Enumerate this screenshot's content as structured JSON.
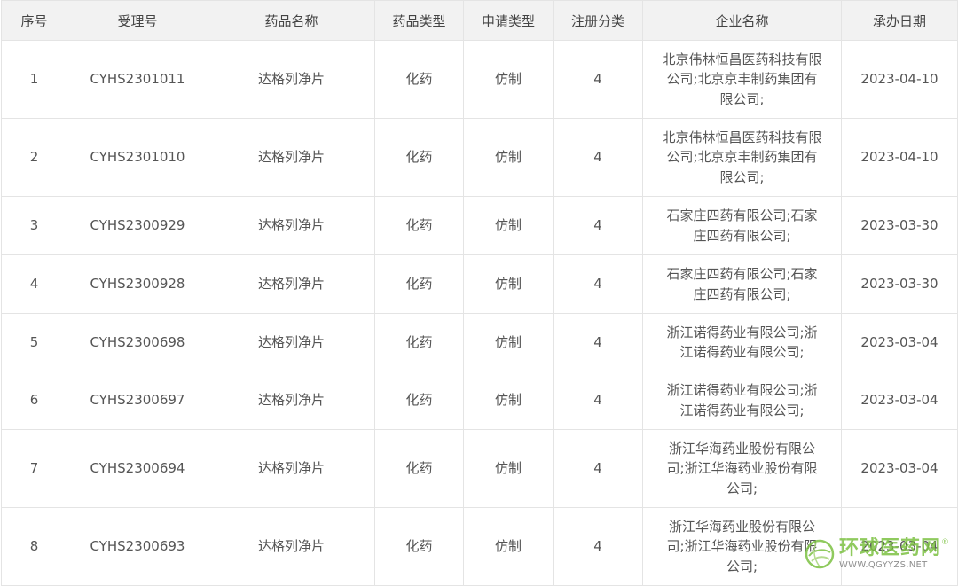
{
  "table": {
    "headers": [
      "序号",
      "受理号",
      "药品名称",
      "药品类型",
      "申请类型",
      "注册分类",
      "企业名称",
      "承办日期"
    ],
    "rows": [
      {
        "seq": "1",
        "accept_no": "CYHS2301011",
        "drug_name": "达格列净片",
        "drug_type": "化药",
        "apply_type": "仿制",
        "reg_class": "4",
        "company": "北京伟林恒昌医药科技有限\n公司;北京京丰制药集团有\n限公司;",
        "date": "2023-04-10"
      },
      {
        "seq": "2",
        "accept_no": "CYHS2301010",
        "drug_name": "达格列净片",
        "drug_type": "化药",
        "apply_type": "仿制",
        "reg_class": "4",
        "company": "北京伟林恒昌医药科技有限\n公司;北京京丰制药集团有\n限公司;",
        "date": "2023-04-10"
      },
      {
        "seq": "3",
        "accept_no": "CYHS2300929",
        "drug_name": "达格列净片",
        "drug_type": "化药",
        "apply_type": "仿制",
        "reg_class": "4",
        "company": "石家庄四药有限公司;石家\n庄四药有限公司;",
        "date": "2023-03-30"
      },
      {
        "seq": "4",
        "accept_no": "CYHS2300928",
        "drug_name": "达格列净片",
        "drug_type": "化药",
        "apply_type": "仿制",
        "reg_class": "4",
        "company": "石家庄四药有限公司;石家\n庄四药有限公司;",
        "date": "2023-03-30"
      },
      {
        "seq": "5",
        "accept_no": "CYHS2300698",
        "drug_name": "达格列净片",
        "drug_type": "化药",
        "apply_type": "仿制",
        "reg_class": "4",
        "company": "浙江诺得药业有限公司;浙\n江诺得药业有限公司;",
        "date": "2023-03-04"
      },
      {
        "seq": "6",
        "accept_no": "CYHS2300697",
        "drug_name": "达格列净片",
        "drug_type": "化药",
        "apply_type": "仿制",
        "reg_class": "4",
        "company": "浙江诺得药业有限公司;浙\n江诺得药业有限公司;",
        "date": "2023-03-04"
      },
      {
        "seq": "7",
        "accept_no": "CYHS2300694",
        "drug_name": "达格列净片",
        "drug_type": "化药",
        "apply_type": "仿制",
        "reg_class": "4",
        "company": "浙江华海药业股份有限公\n司;浙江华海药业股份有限\n公司;",
        "date": "2023-03-04"
      },
      {
        "seq": "8",
        "accept_no": "CYHS2300693",
        "drug_name": "达格列净片",
        "drug_type": "化药",
        "apply_type": "仿制",
        "reg_class": "4",
        "company": "浙江华海药业股份有限公\n司;浙江华海药业股份有限\n公司;",
        "date": "2023-03-04"
      }
    ]
  },
  "watermark": {
    "name": "环球医药网",
    "registered": "®",
    "url": "WWW.QGYYZS.NET",
    "icon": "globe-leaf-icon",
    "color": "#7cc142"
  }
}
